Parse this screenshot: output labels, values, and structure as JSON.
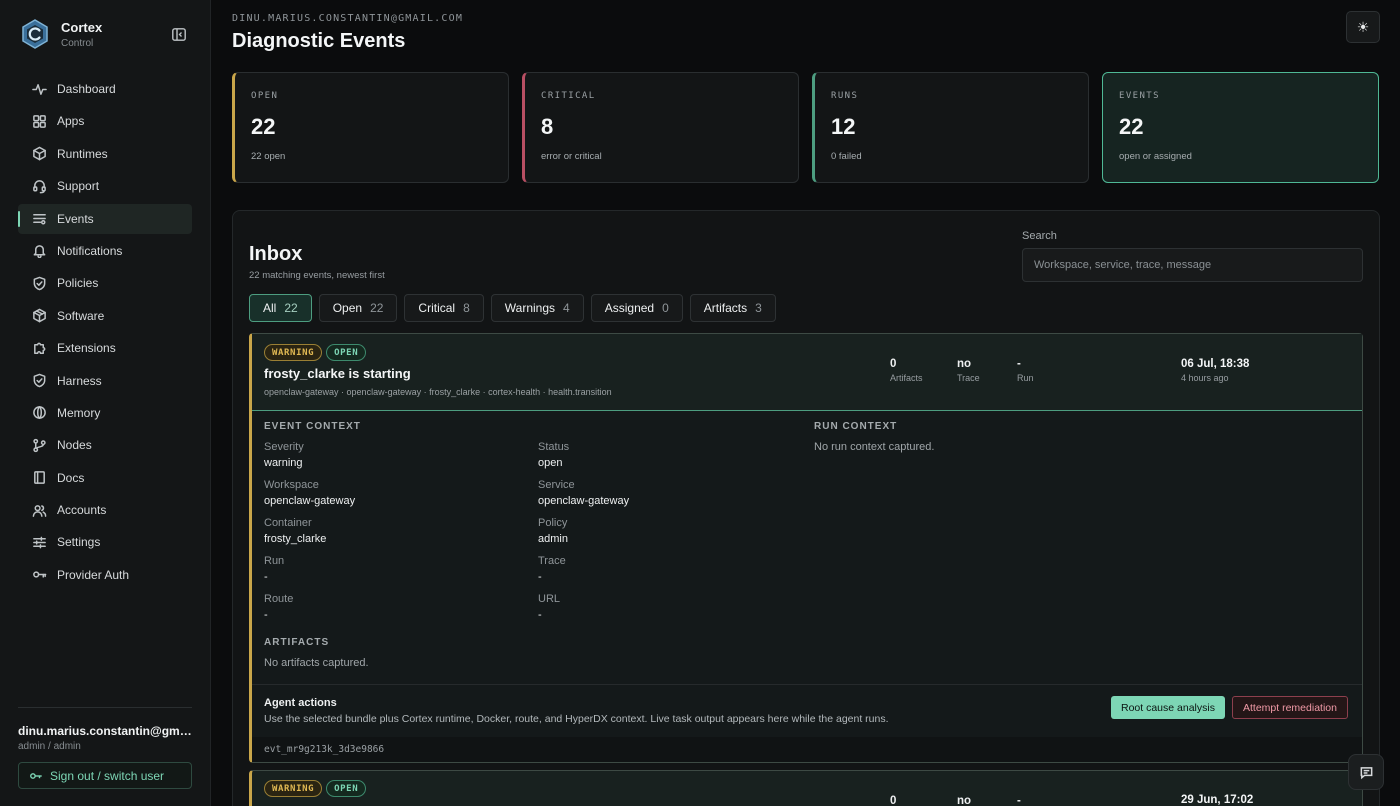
{
  "brand": {
    "name": "Cortex",
    "sub": "Control"
  },
  "nav": {
    "items": [
      {
        "label": "Dashboard",
        "icon": "activity-icon"
      },
      {
        "label": "Apps",
        "icon": "grid-icon"
      },
      {
        "label": "Runtimes",
        "icon": "cube-icon"
      },
      {
        "label": "Support",
        "icon": "support-icon"
      },
      {
        "label": "Events",
        "icon": "sliders-icon",
        "active": true
      },
      {
        "label": "Notifications",
        "icon": "bell-icon"
      },
      {
        "label": "Policies",
        "icon": "shield-check-icon"
      },
      {
        "label": "Software",
        "icon": "package-icon"
      },
      {
        "label": "Extensions",
        "icon": "puzzle-icon"
      },
      {
        "label": "Harness",
        "icon": "shield-icon"
      },
      {
        "label": "Memory",
        "icon": "brain-icon"
      },
      {
        "label": "Nodes",
        "icon": "git-branch-icon"
      },
      {
        "label": "Docs",
        "icon": "book-icon"
      },
      {
        "label": "Accounts",
        "icon": "users-icon"
      },
      {
        "label": "Settings",
        "icon": "settings-sliders-icon"
      },
      {
        "label": "Provider Auth",
        "icon": "key-icon"
      }
    ]
  },
  "user": {
    "email": "dinu.marius.constantin@gmail.com",
    "role": "admin / admin",
    "signout_label": "Sign out / switch user"
  },
  "header": {
    "account": "DINU.MARIUS.CONSTANTIN@GMAIL.COM",
    "title": "Diagnostic Events",
    "theme_icon": "☀"
  },
  "stats": [
    {
      "label": "OPEN",
      "value": "22",
      "sub": "22 open"
    },
    {
      "label": "CRITICAL",
      "value": "8",
      "sub": "error or critical"
    },
    {
      "label": "RUNS",
      "value": "12",
      "sub": "0 failed"
    },
    {
      "label": "EVENTS",
      "value": "22",
      "sub": "open or assigned"
    }
  ],
  "inbox": {
    "title": "Inbox",
    "subtitle": "22 matching events, newest first",
    "search_label": "Search",
    "search_placeholder": "Workspace, service, trace, message",
    "filters": [
      {
        "label": "All",
        "count": "22",
        "active": true
      },
      {
        "label": "Open",
        "count": "22"
      },
      {
        "label": "Critical",
        "count": "8"
      },
      {
        "label": "Warnings",
        "count": "4"
      },
      {
        "label": "Assigned",
        "count": "0"
      },
      {
        "label": "Artifacts",
        "count": "3"
      }
    ]
  },
  "event": {
    "severity_badge": "WARNING",
    "status_badge": "OPEN",
    "title": "frosty_clarke is starting",
    "path": "openclaw-gateway · openclaw-gateway · frosty_clarke · cortex-health · health.transition",
    "artifacts_value": "0",
    "artifacts_label": "Artifacts",
    "trace_value": "no",
    "trace_label": "Trace",
    "run_value": "-",
    "run_label": "Run",
    "date": "06 Jul, 18:38",
    "ago": "4 hours ago",
    "context_title": "EVENT CONTEXT",
    "fields": {
      "severity": {
        "k": "Severity",
        "v": "warning"
      },
      "status": {
        "k": "Status",
        "v": "open"
      },
      "workspace": {
        "k": "Workspace",
        "v": "openclaw-gateway"
      },
      "service": {
        "k": "Service",
        "v": "openclaw-gateway"
      },
      "container": {
        "k": "Container",
        "v": "frosty_clarke"
      },
      "policy": {
        "k": "Policy",
        "v": "admin"
      },
      "run": {
        "k": "Run",
        "v": "-"
      },
      "trace": {
        "k": "Trace",
        "v": "-"
      },
      "route": {
        "k": "Route",
        "v": "-"
      },
      "url": {
        "k": "URL",
        "v": "-"
      }
    },
    "run_context_title": "RUN CONTEXT",
    "run_context_empty": "No run context captured.",
    "artifacts_title": "ARTIFACTS",
    "artifacts_empty": "No artifacts captured.",
    "agent_title": "Agent actions",
    "agent_desc": "Use the selected bundle plus Cortex runtime, Docker, route, and HyperDX context. Live task output appears here while the agent runs.",
    "rca_label": "Root cause analysis",
    "remediate_label": "Attempt remediation",
    "id": "evt_mr9g213k_3d3e9866"
  },
  "event2": {
    "severity_badge": "WARNING",
    "status_badge": "OPEN",
    "artifacts_value": "0",
    "trace_value": "no",
    "run_value": "-",
    "date": "29 Jun, 17:02"
  }
}
